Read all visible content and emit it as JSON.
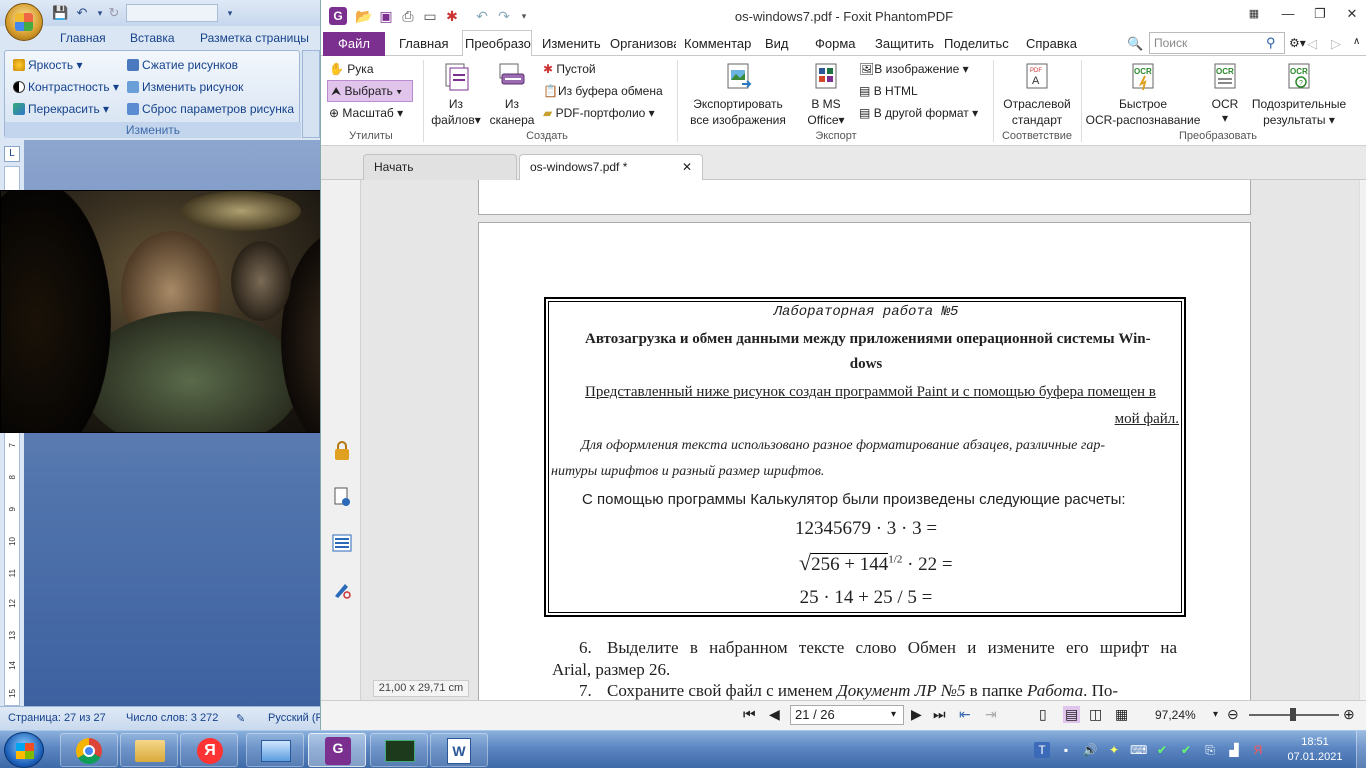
{
  "word": {
    "tabs": [
      "Главная",
      "Вставка",
      "Разметка страницы"
    ],
    "ribbon": {
      "left": [
        "Яркость",
        "Контрастность",
        "Перекрасить"
      ],
      "right": [
        "Сжатие рисунков",
        "Изменить рисунок",
        "Сброс параметров рисунка"
      ],
      "group_label": "Изменить"
    },
    "ruler_numbers": [
      "7",
      "8",
      "9",
      "10",
      "11",
      "12",
      "13",
      "14",
      "15"
    ],
    "status": {
      "page": "Страница: 27 из 27",
      "words": "Число слов: 3 272",
      "lang": "Русский (Р"
    }
  },
  "foxit": {
    "title": "os-windows7.pdf - Foxit PhantomPDF",
    "menu": {
      "file": "Файл",
      "tabs": [
        "Главная",
        "Изменить",
        "Организова",
        "Комментар",
        "Вид",
        "Форма",
        "Защитить",
        "Поделитьс",
        "Справка"
      ],
      "active_tab": "Преобразо",
      "search_placeholder": "Поиск"
    },
    "ribbon": {
      "utilities": {
        "hand": "Рука",
        "select": "Выбрать",
        "zoom": "Масштаб",
        "label": "Утилиты"
      },
      "create": {
        "from_files_1": "Из",
        "from_files_2": "файлов",
        "from_scanner_1": "Из",
        "from_scanner_2": "сканера",
        "blank": "Пустой",
        "from_clipboard": "Из буфера обмена",
        "portfolio": "PDF-портфолио",
        "label": "Создать"
      },
      "export": {
        "export_images_1": "Экспортировать",
        "export_images_2": "все изображения",
        "ms_office_1": "В MS",
        "ms_office_2": "Office",
        "to_image": "В изображение",
        "to_html": "В HTML",
        "to_other": "В другой формат",
        "label": "Экспорт"
      },
      "compliance": {
        "industry_1": "Отраслевой",
        "industry_2": "стандарт",
        "label": "Соответствие"
      },
      "convert": {
        "quick_ocr_1": "Быстрое",
        "quick_ocr_2": "OCR-распознавание",
        "ocr": "OCR",
        "suspicious_1": "Подозрительные",
        "suspicious_2": "результаты",
        "label": "Преобразовать"
      }
    },
    "doc_tabs": {
      "start": "Начать",
      "current": "os-windows7.pdf *"
    },
    "page": {
      "lab_title": "Лабораторная работа №5",
      "heading_1": "Автозагрузка и обмен данными между приложениями операционной системы Win-",
      "heading_2": "dows",
      "underline_1": "Представленный ниже рисунок создан программой Paint и с помощью буфера помещен в",
      "underline_2": "мой файл.",
      "italic_1": "Для оформления текста использовано разное форматирование абзацев, различные гар-",
      "italic_2": "нитуры шрифтов и разный размер шрифтов.",
      "arial_line": "С помощью программы Калькулятор были произведены следующие расчеты:",
      "formula_1": "12345679 · 3 · 3 =",
      "formula_2_a": "256 + 144",
      "formula_2_exp": "1/2",
      "formula_2_b": " · 22 =",
      "formula_3": "25 · 14 + 25 / 5 =",
      "item6_num": "6.",
      "item6_a": "Выделите в набранном тексте слово Обмен и измените его шрифт на",
      "item6_b": "Arial, размер 26.",
      "item7_num": "7.",
      "item7_a": "Сохраните свой файл с именем ",
      "item7_italic1": "Документ ЛР №5",
      "item7_mid": " в папке ",
      "item7_italic2": "Работа",
      "item7_end": ". По-"
    },
    "page_size": "21,00 x 29,71 cm",
    "status": {
      "page_input": "21 / 26",
      "zoom": "97,24%"
    }
  },
  "taskbar": {
    "time": "18:51",
    "date": "07.01.2021"
  },
  "colors": {
    "foxit_purple": "#7b2f8f",
    "word_blue": "#15428b"
  }
}
